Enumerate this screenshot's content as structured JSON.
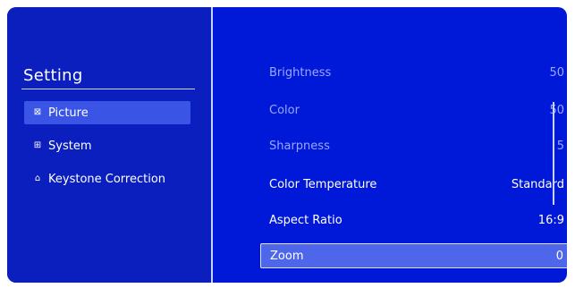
{
  "sidebar": {
    "title": "Setting",
    "items": [
      {
        "label": "Picture",
        "icon": "picture-icon",
        "glyph": "⊠",
        "active": true
      },
      {
        "label": "System",
        "icon": "system-icon",
        "glyph": "⊞",
        "active": false
      },
      {
        "label": "Keystone Correction",
        "icon": "keystone-icon",
        "glyph": "⌂",
        "active": false
      }
    ]
  },
  "settings": [
    {
      "label": "Brightness",
      "value": "50",
      "state": "dim"
    },
    {
      "label": "Color",
      "value": "50",
      "state": "dim"
    },
    {
      "label": "Sharpness",
      "value": "5",
      "state": "dim"
    },
    {
      "label": "Color Temperature",
      "value": "Standard",
      "state": "normal"
    },
    {
      "label": "Aspect Ratio",
      "value": "16:9",
      "state": "normal"
    },
    {
      "label": "Zoom",
      "value": "0",
      "state": "selected"
    }
  ],
  "colors": {
    "background": "#0018d8",
    "sidebar": "#0a1fbd",
    "highlight": "#4d66ea",
    "dim_text": "#9aa8ff"
  }
}
